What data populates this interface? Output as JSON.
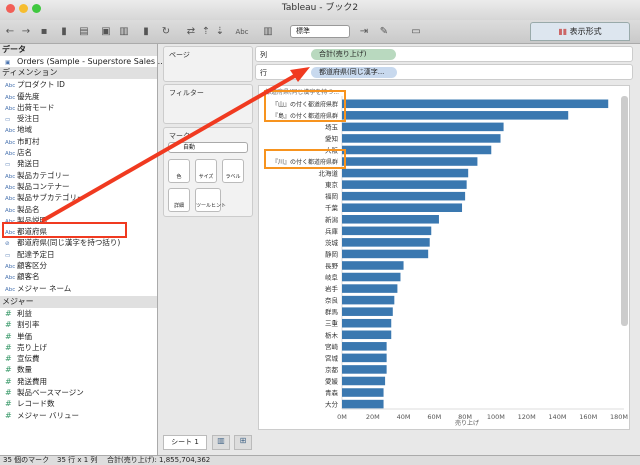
{
  "window": {
    "title": "Tableau - ブック2"
  },
  "toolbar": {
    "format_select": "標準",
    "show_me": "表示形式"
  },
  "data_pane": {
    "header": "データ",
    "source": "Orders (Sample - Superstore Sales ...",
    "dimensions_header": "ディメンション",
    "dimensions": [
      {
        "type": "Abc",
        "label": "プロダクト ID"
      },
      {
        "type": "Abc",
        "label": "優先度"
      },
      {
        "type": "Abc",
        "label": "出荷モード"
      },
      {
        "type": "date",
        "label": "受注日"
      },
      {
        "type": "Abc",
        "label": "地域"
      },
      {
        "type": "Abc",
        "label": "市町村"
      },
      {
        "type": "Abc",
        "label": "店名"
      },
      {
        "type": "date",
        "label": "発送日"
      },
      {
        "type": "Abc",
        "label": "製品カテゴリー"
      },
      {
        "type": "Abc",
        "label": "製品コンテナー"
      },
      {
        "type": "Abc",
        "label": "製品サブカテゴリー"
      },
      {
        "type": "Abc",
        "label": "製品名"
      },
      {
        "type": "Abc",
        "label": "製品説明"
      },
      {
        "type": "Abc",
        "label": "都道府県"
      },
      {
        "type": "group",
        "label": "都道府県(同じ漢字を持つ括り)"
      },
      {
        "type": "date",
        "label": "配達予定日"
      },
      {
        "type": "Abc",
        "label": "顧客区分"
      },
      {
        "type": "Abc",
        "label": "顧客名"
      },
      {
        "type": "Abc",
        "label": "メジャー ネーム"
      }
    ],
    "measures_header": "メジャー",
    "measures": [
      "利益",
      "割引率",
      "単価",
      "売り上げ",
      "宣伝費",
      "数量",
      "発送費用",
      "製品ベースマージン",
      "レコード数",
      "メジャー バリュー"
    ]
  },
  "cards": {
    "pages": "ページ",
    "filters": "フィルター",
    "marks": "マーク",
    "mark_type": "自動",
    "color": "色",
    "size": "サイズ",
    "label": "ラベル",
    "detail": "詳細",
    "tooltip": "ツールヒント"
  },
  "shelves": {
    "columns_label": "列",
    "columns_pill": "合計(売り上げ)",
    "rows_label": "行",
    "rows_pill": "都道府県(同じ漢字..."
  },
  "sheet_tabs": [
    "シート 1"
  ],
  "status": {
    "marks": "35 個のマーク",
    "rows_cols": "35 行 x 1 列",
    "sum": "合計(売り上げ): 1,855,704,362"
  },
  "colors": {
    "bar": "#3a78b0",
    "highlight_red": "#f03a20",
    "highlight_orange": "#f7931e"
  },
  "chart_data": {
    "type": "bar",
    "orientation": "horizontal",
    "header": "都道府県(同じ漢字を持つ...",
    "xlabel": "売り上げ",
    "xlim": [
      0,
      180
    ],
    "xunit": "M",
    "xticks": [
      "0M",
      "20M",
      "40M",
      "60M",
      "80M",
      "100M",
      "120M",
      "140M",
      "160M",
      "180M"
    ],
    "categories": [
      "『山』の付く都道府県群",
      "『島』の付く都道府県群",
      "埼玉",
      "愛知",
      "大阪",
      "『川』の付く都道府県群",
      "北海道",
      "東京",
      "福岡",
      "千葉",
      "新潟",
      "兵庫",
      "茨城",
      "静岡",
      "長野",
      "岐阜",
      "岩手",
      "奈良",
      "群馬",
      "三重",
      "栃木",
      "宮崎",
      "宮城",
      "京都",
      "愛媛",
      "青森",
      "大分"
    ],
    "values": [
      173,
      147,
      105,
      103,
      97,
      88,
      82,
      81,
      80,
      78,
      63,
      58,
      57,
      56,
      40,
      38,
      36,
      34,
      33,
      32,
      32,
      29,
      29,
      29,
      28,
      27,
      27
    ],
    "highlighted": [
      "『山』の付く都道府県群",
      "『島』の付く都道府県群",
      "『川』の付く都道府県群"
    ]
  }
}
